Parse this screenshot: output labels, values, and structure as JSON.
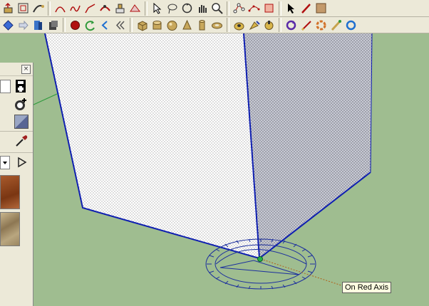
{
  "toolbar_top": {
    "tools": [
      {
        "name": "push-pull-icon"
      },
      {
        "name": "offset-icon"
      },
      {
        "name": "follow-me-icon"
      },
      {
        "name": "arc-icon"
      },
      {
        "name": "freehand-icon"
      },
      {
        "name": "curve-icon"
      },
      {
        "name": "smoove-icon"
      },
      {
        "name": "stamp-icon"
      },
      {
        "name": "drape-icon"
      },
      {
        "name": "select-icon"
      },
      {
        "name": "lasso-icon"
      },
      {
        "name": "orbit-icon"
      },
      {
        "name": "pan-icon"
      },
      {
        "name": "zoom-icon"
      },
      {
        "name": "node-edit-icon"
      },
      {
        "name": "connect-dots-icon"
      },
      {
        "name": "rotate-icon"
      },
      {
        "name": "arrow-icon"
      },
      {
        "name": "pencil-icon"
      },
      {
        "name": "rectangle-icon"
      }
    ]
  },
  "toolbar_bottom": {
    "tools": [
      {
        "name": "diamond-icon"
      },
      {
        "name": "arrow-right-icon"
      },
      {
        "name": "component-icon"
      },
      {
        "name": "group-icon"
      },
      {
        "name": "record-icon"
      },
      {
        "name": "undo-icon"
      },
      {
        "name": "back-icon"
      },
      {
        "name": "collapse-icon"
      },
      {
        "name": "box-icon"
      },
      {
        "name": "cylinder-icon"
      },
      {
        "name": "sphere-icon"
      },
      {
        "name": "cone-icon"
      },
      {
        "name": "tube-icon"
      },
      {
        "name": "torus-icon"
      },
      {
        "name": "camera-icon"
      },
      {
        "name": "paint-icon"
      },
      {
        "name": "color-icon"
      },
      {
        "name": "refresh-icon"
      },
      {
        "name": "measure-icon"
      },
      {
        "name": "cycle-icon"
      },
      {
        "name": "pin-icon"
      },
      {
        "name": "circle-icon"
      }
    ]
  },
  "tooltip": {
    "text": "On Red Axis"
  },
  "materials_panel": {
    "close_label": "×"
  }
}
